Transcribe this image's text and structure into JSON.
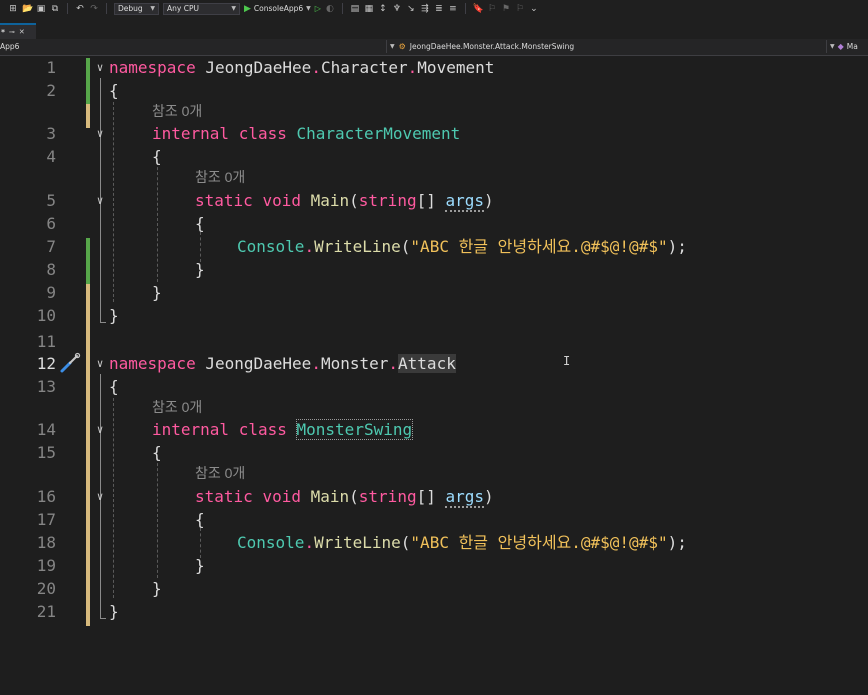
{
  "toolbar": {
    "config": "Debug",
    "platform": "Any CPU",
    "run_target": "ConsoleApp6"
  },
  "tab": {
    "label": "*"
  },
  "navbar": {
    "project": "App6",
    "scope": "JeongDaeHee.Monster.Attack.MonsterSwing",
    "member": "Ma"
  },
  "codelens": {
    "references": "참조 0개"
  },
  "code": {
    "namespace_kw": "namespace",
    "internal_kw": "internal",
    "class_kw": "class",
    "static_kw": "static",
    "void_kw": "void",
    "string_kw": "string",
    "ns1_a": "JeongDaeHee",
    "ns1_b": "Character",
    "ns1_c": "Movement",
    "class1": "CharacterMovement",
    "ns2_a": "JeongDaeHee",
    "ns2_b": "Monster",
    "ns2_c": "Attack",
    "class2": "MonsterSwing",
    "main": "Main",
    "args": "args",
    "console": "Console",
    "writeline": "WriteLine",
    "literal": "\"ABC 한글 안녕하세요.@#$@!@#$\"",
    "open_brace": "{",
    "close_brace": "}",
    "dot": ".",
    "brackets": "[]",
    "paren_open": "(",
    "paren_close": ")",
    "paren_semicolon": ");"
  },
  "line_numbers": [
    "1",
    "2",
    "3",
    "4",
    "5",
    "6",
    "7",
    "8",
    "9",
    "10",
    "11",
    "12",
    "13",
    "14",
    "15",
    "16",
    "17",
    "18",
    "19",
    "20",
    "21"
  ],
  "colors": {
    "keyword": "#ff5aa0",
    "type": "#4ec9b0",
    "method": "#dcdcaa",
    "string": "#f1c15a",
    "parameter": "#9cdcfe",
    "change_saved": "#57a64a",
    "change_unsaved": "#d7ba7d"
  },
  "icons": {
    "quick_actions": "screwdriver-icon"
  }
}
